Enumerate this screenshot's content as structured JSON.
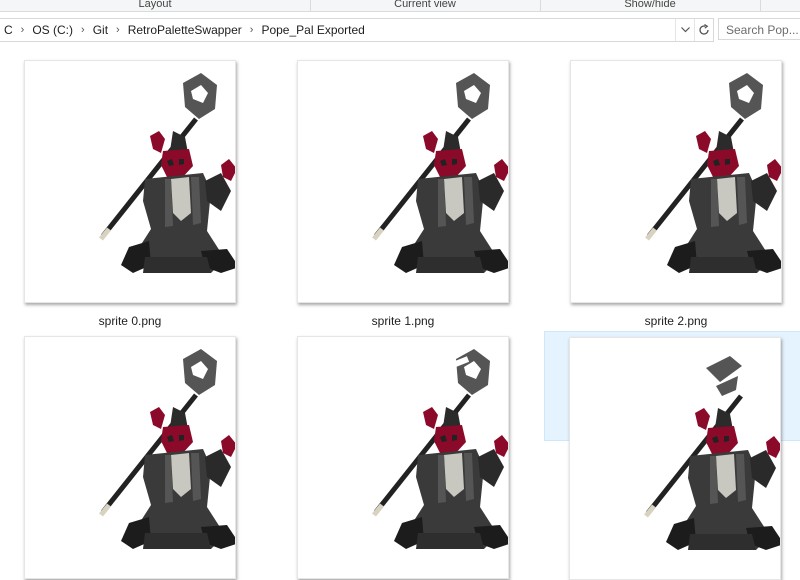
{
  "ribbon": {
    "groups": [
      "Layout",
      "Current view",
      "Show/hide"
    ]
  },
  "address_bar": {
    "crumbs": [
      "C",
      "OS (C:)",
      "Git",
      "RetroPaletteSwapper",
      "Pope_Pal Exported"
    ],
    "separator": "›",
    "dropdown_icon": "chevron-down-icon",
    "refresh_icon": "refresh-icon"
  },
  "search": {
    "placeholder": "Search Pop..."
  },
  "files": [
    {
      "name": "sprite 0.png",
      "selected": false
    },
    {
      "name": "sprite 1.png",
      "selected": false
    },
    {
      "name": "sprite 2.png",
      "selected": false
    },
    {
      "name": "",
      "selected": false
    },
    {
      "name": "",
      "selected": false
    },
    {
      "name": "",
      "selected": true
    }
  ],
  "colors": {
    "selection_bg": "#e5f3ff",
    "sprite_robe": "#3a3a3a",
    "sprite_face": "#8b0a2a"
  }
}
